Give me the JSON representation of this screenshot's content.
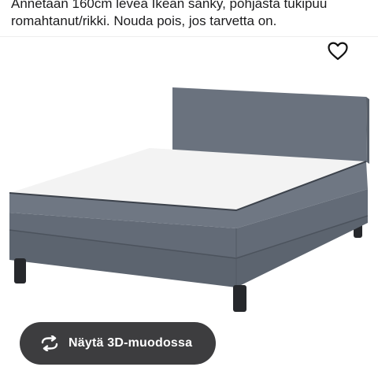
{
  "listing": {
    "description_lines": [
      "Annetaan 160cm levea Ikean sänky, pohjasta tukipuu",
      "romahtanut/rikki. Nouda pois, jos tarvetta on."
    ]
  },
  "actions": {
    "favorite_icon": "heart-outline-icon",
    "view_3d_label": "Näytä 3D-muodossa",
    "view_3d_icon": "rotate-arrows-icon"
  },
  "colors": {
    "fabric": "#6c7480",
    "mattress": "#f4f4f4",
    "button_bg": "#3d3d3f"
  }
}
